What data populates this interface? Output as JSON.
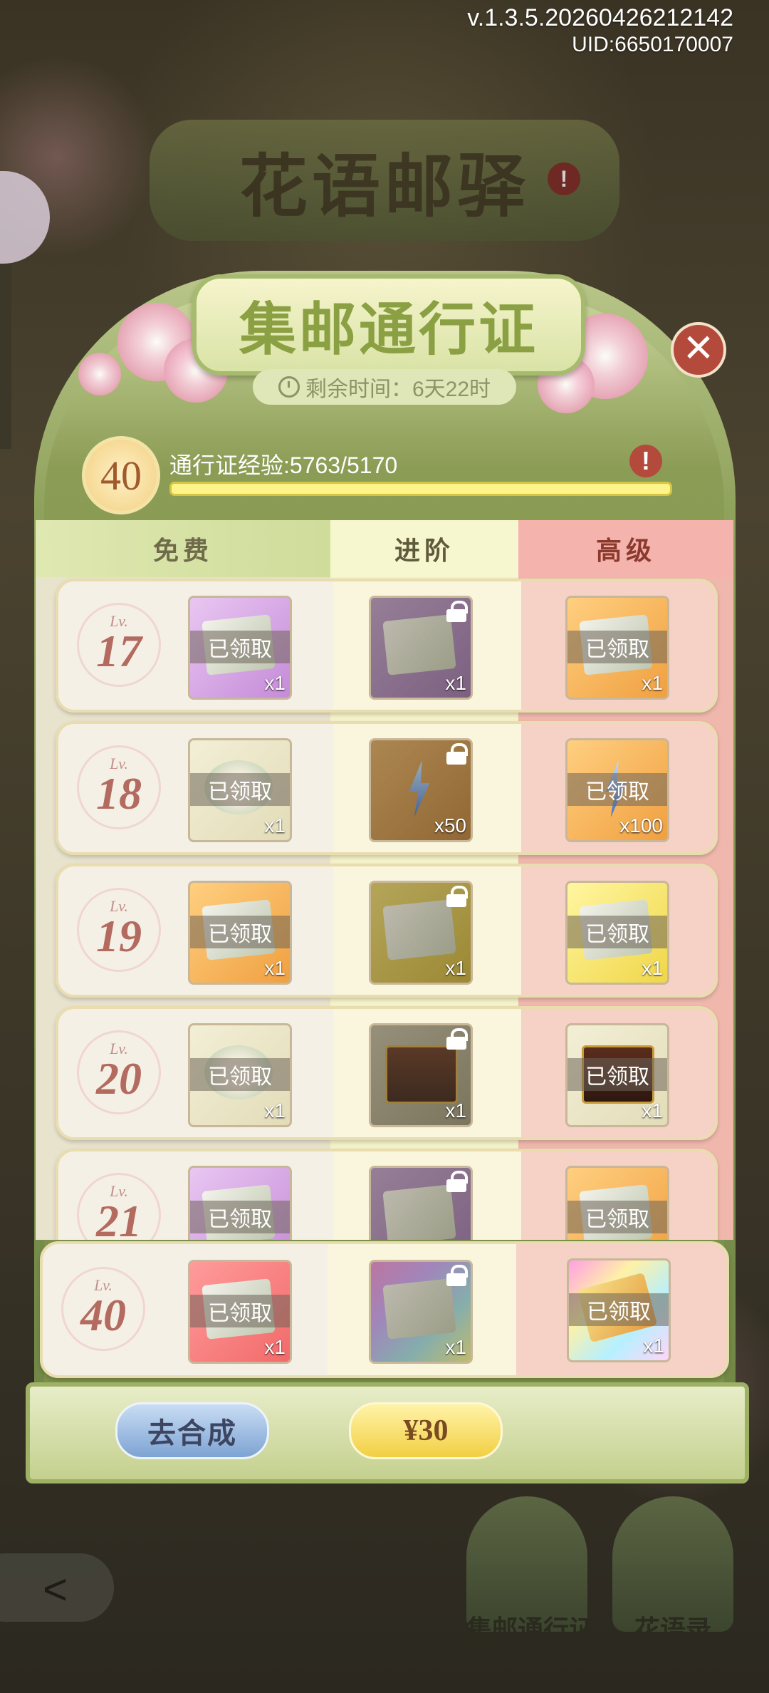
{
  "version": "v.1.3.5.20260426212142",
  "uid": "UID:6650170007",
  "background": {
    "title": "花语邮驿",
    "warn_icon": "!"
  },
  "panel": {
    "title": "集邮通行证",
    "time_left": "剩余时间：6天22时",
    "close_icon": "✕",
    "level": "40",
    "exp_label": "通行证经验:5763/5170",
    "exp_progress": 1.0,
    "info_icon": "!"
  },
  "columns": {
    "free": "免费",
    "advanced": "进阶",
    "premium": "高级"
  },
  "rows": [
    {
      "lv": "17",
      "free": {
        "qty": "x1",
        "badge": "已领取"
      },
      "adv": {
        "qty": "x1",
        "locked": true
      },
      "pre": {
        "qty": "x1",
        "badge": "已领取"
      }
    },
    {
      "lv": "18",
      "free": {
        "qty": "x1",
        "badge": "已领取"
      },
      "adv": {
        "qty": "x50",
        "locked": true
      },
      "pre": {
        "qty": "x100",
        "badge": "已领取"
      }
    },
    {
      "lv": "19",
      "free": {
        "qty": "x1",
        "badge": "已领取"
      },
      "adv": {
        "qty": "x1",
        "locked": true
      },
      "pre": {
        "qty": "x1",
        "badge": "已领取"
      }
    },
    {
      "lv": "20",
      "free": {
        "qty": "x1",
        "badge": "已领取"
      },
      "adv": {
        "qty": "x1",
        "locked": true
      },
      "pre": {
        "qty": "x1",
        "badge": "已领取"
      }
    },
    {
      "lv": "21",
      "free": {
        "qty": "",
        "badge": "已领取"
      },
      "adv": {
        "qty": "",
        "locked": true
      },
      "pre": {
        "qty": "",
        "badge": "已领取"
      }
    }
  ],
  "pinned_row": {
    "lv": "40",
    "free": {
      "qty": "x1",
      "badge": "已领取"
    },
    "adv": {
      "qty": "x1",
      "locked": true
    },
    "pre": {
      "qty": "x1",
      "badge": "已领取"
    }
  },
  "lv_prefix": "Lv.",
  "bottom": {
    "synth_label": "去合成",
    "price_label": "¥30"
  },
  "nav": {
    "pass_label": "集邮通行证",
    "flower_label": "花语录",
    "back_icon": "<"
  }
}
